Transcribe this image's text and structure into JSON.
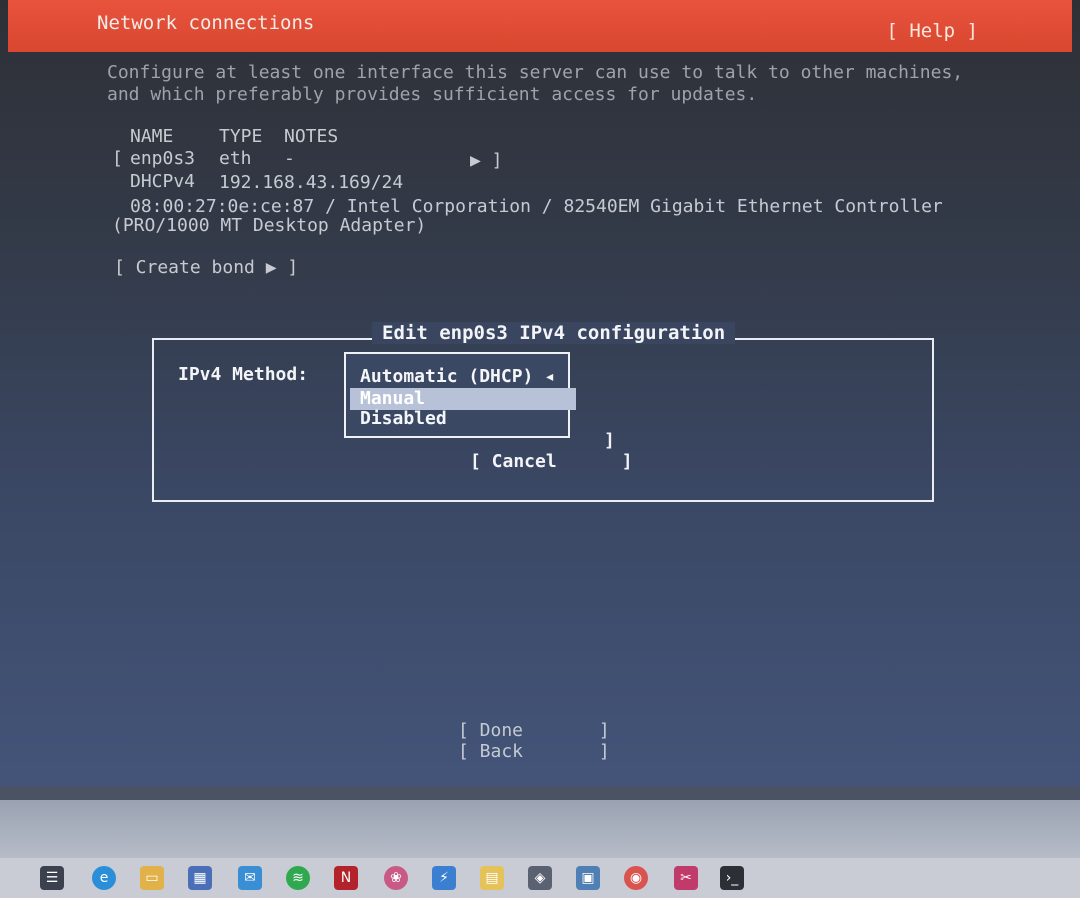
{
  "header": {
    "title": "Network connections",
    "help": "[ Help ]"
  },
  "intro": {
    "line1": "Configure at least one interface this server can use to talk to other machines,",
    "line2": "and which preferably provides sufficient access for updates."
  },
  "table": {
    "headers": [
      "NAME",
      "TYPE",
      "NOTES"
    ],
    "row": {
      "prefix": "[",
      "name": "enp0s3",
      "type": "eth",
      "notes": "-",
      "arrow": "▶ ]"
    },
    "dhcp_label": "DHCPv4",
    "dhcp_value": "192.168.43.169/24",
    "mac_line": "08:00:27:0e:ce:87 / Intel Corporation / 82540EM Gigabit Ethernet Controller",
    "adapter_line": "(PRO/1000 MT Desktop Adapter)"
  },
  "create_bond": "[ Create bond ▶ ]",
  "dialog": {
    "title": "Edit enp0s3 IPv4 configuration",
    "method_label": "IPv4 Method:",
    "options": [
      "Automatic (DHCP) ◂",
      "Manual",
      "Disabled"
    ],
    "selected_option": "Manual",
    "cancel": "[ Cancel      ]",
    "save_bracket": "]"
  },
  "footer": {
    "done": "[ Done       ]",
    "back": "[ Back       ]"
  },
  "taskbar_icons": [
    "task-view-icon",
    "edge-icon",
    "file-explorer-icon",
    "store-icon",
    "mail-icon",
    "spotify-icon",
    "netflix-icon",
    "photos-icon",
    "app-icon",
    "notes-icon",
    "3d-viewer-icon",
    "remote-desktop-icon",
    "chrome-icon",
    "snip-icon",
    "terminal-icon"
  ]
}
